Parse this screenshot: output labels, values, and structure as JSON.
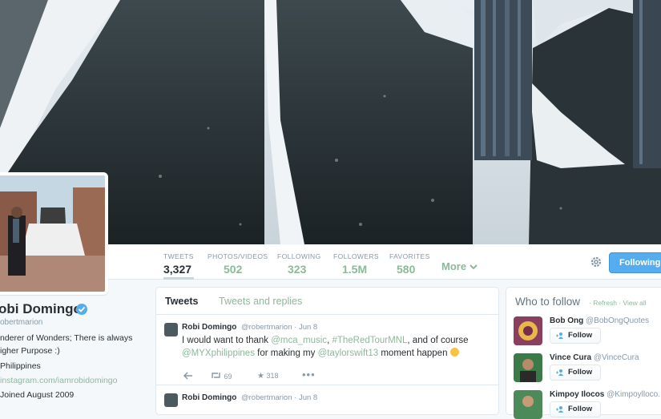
{
  "nav": {
    "stats": [
      {
        "label": "TWEETS",
        "value": "3,327"
      },
      {
        "label": "PHOTOS/VIDEOS",
        "value": "502"
      },
      {
        "label": "FOLLOWING",
        "value": "323"
      },
      {
        "label": "FOLLOWERS",
        "value": "1.5M"
      },
      {
        "label": "FAVORITES",
        "value": "580"
      }
    ],
    "more_label": "More",
    "following_label": "Following"
  },
  "profile": {
    "name": "obi Domingo",
    "handle": "obertmarion",
    "bio": "nderer of Wonders; There is always igher Purpose :)",
    "location": "Philippines",
    "website": "instagram.com/iamrobidomingo",
    "joined": "Joined August 2009"
  },
  "timeline": {
    "tabs": [
      "Tweets",
      "Tweets and replies"
    ],
    "tweets": [
      {
        "name": "Robi Domingo",
        "handle_date": "@robertmarion · Jun 8",
        "text_parts": [
          {
            "t": "I would want to thank ",
            "hl": false
          },
          {
            "t": "@mca_music",
            "hl": true
          },
          {
            "t": ", ",
            "hl": false
          },
          {
            "t": "#TheRedTourMNL",
            "hl": true
          },
          {
            "t": ", and of course ",
            "hl": false
          },
          {
            "t": "@MYXphilippines",
            "hl": true
          },
          {
            "t": " for making my ",
            "hl": false
          },
          {
            "t": "@taylorswift13",
            "hl": true
          },
          {
            "t": " moment happen ",
            "hl": false
          }
        ],
        "retweets": "69",
        "favorites": "318"
      },
      {
        "name": "Robi Domingo",
        "handle_date": "@robertmarion · Jun 8"
      }
    ]
  },
  "who_to_follow": {
    "title": "Who to follow",
    "links": "· Refresh · View all",
    "follow_label": "Follow",
    "suggestions": [
      {
        "name": "Bob Ong",
        "handle": "@BobOngQuotes"
      },
      {
        "name": "Vince Cura",
        "handle": "@VinceCura"
      },
      {
        "name": "Kimpoy Ilocos",
        "handle": "@Kimpoyllocо..."
      }
    ]
  },
  "colors": {
    "link": "#8db89a",
    "button_blue": "#55acee",
    "text": "#292f33",
    "muted": "#8899a6"
  }
}
